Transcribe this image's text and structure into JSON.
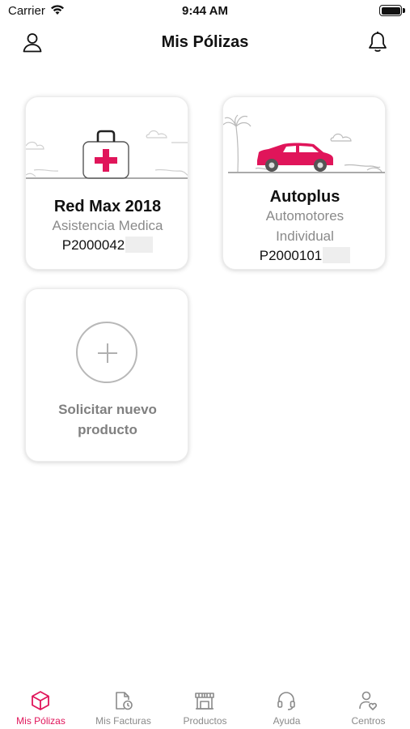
{
  "status_bar": {
    "carrier": "Carrier",
    "time": "9:44 AM"
  },
  "nav": {
    "title": "Mis Pólizas",
    "left_icon": "user-icon",
    "right_icon": "bell-icon"
  },
  "policies": [
    {
      "name": "Red Max 2018",
      "type": "Asistencia Medica",
      "number": "P2000042",
      "illustration": "medical-kit"
    },
    {
      "name": "Autoplus",
      "type_line1": "Automotores",
      "type_line2": "Individual",
      "number": "P2000101",
      "illustration": "car"
    }
  ],
  "new_product": {
    "line1": "Solicitar nuevo",
    "line2": "producto"
  },
  "tabs": [
    {
      "label": "Mis Pólizas",
      "icon": "cube-icon",
      "active": true
    },
    {
      "label": "Mis Facturas",
      "icon": "invoice-clock-icon",
      "active": false
    },
    {
      "label": "Productos",
      "icon": "store-icon",
      "active": false
    },
    {
      "label": "Ayuda",
      "icon": "headset-icon",
      "active": false
    },
    {
      "label": "Centros",
      "icon": "user-heart-icon",
      "active": false
    }
  ],
  "colors": {
    "accent": "#e0155a",
    "text": "#111111",
    "muted": "#8a8a8a"
  }
}
